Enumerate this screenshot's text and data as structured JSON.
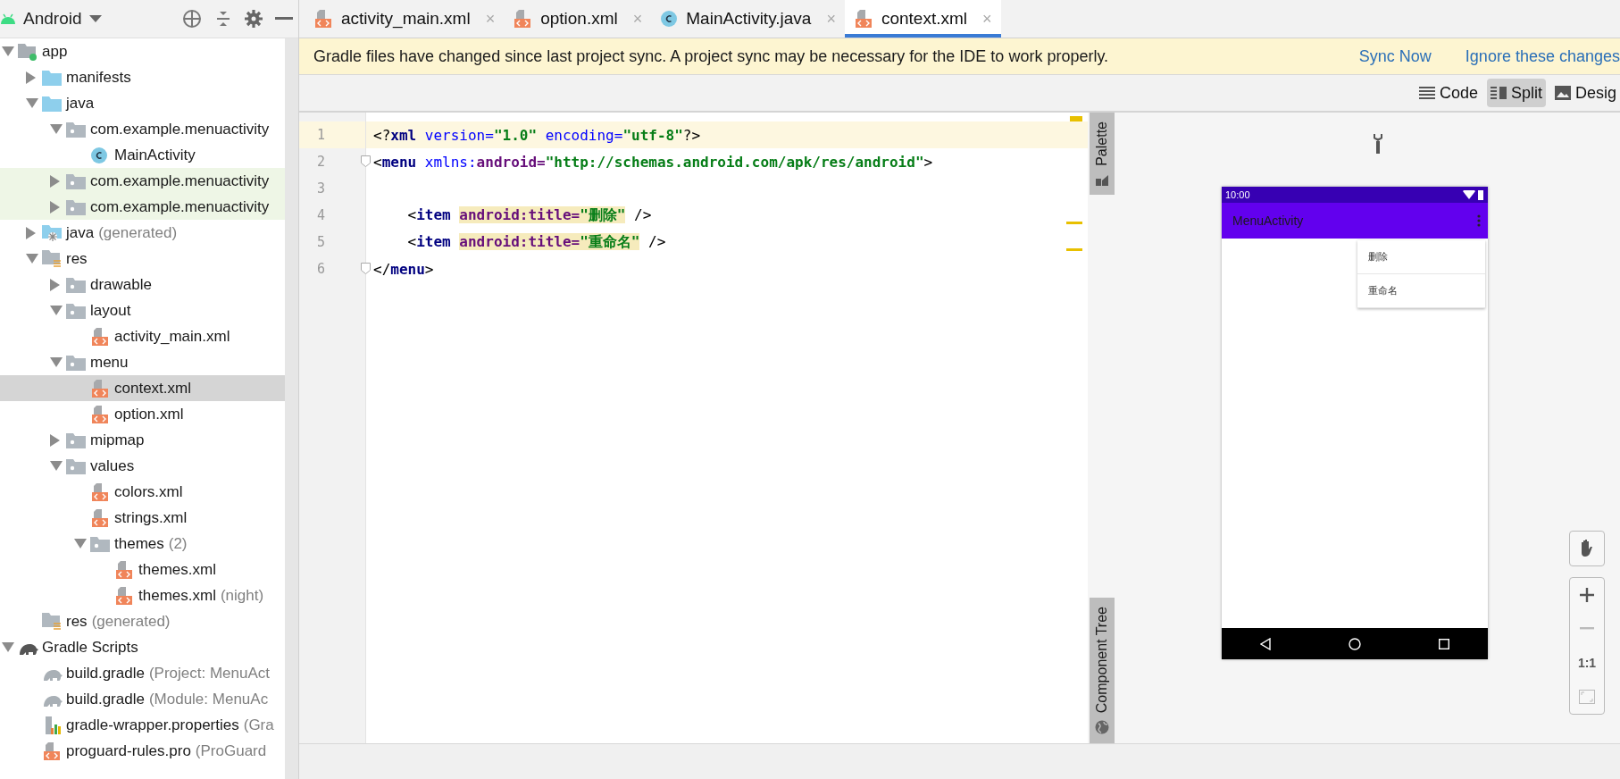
{
  "project_panel": {
    "view": "Android",
    "tree": [
      {
        "label": "app",
        "kind": "module",
        "expanded": true,
        "selected": false,
        "highlighted": false,
        "children": [
          {
            "label": "manifests",
            "kind": "folder",
            "expanded": false,
            "selected": false,
            "highlighted": false
          },
          {
            "label": "java",
            "kind": "folder",
            "expanded": true,
            "selected": false,
            "highlighted": false,
            "children": [
              {
                "label": "com.example.menuactivity",
                "kind": "package",
                "expanded": true,
                "selected": false,
                "highlighted": false,
                "children": [
                  {
                    "label": "MainActivity",
                    "kind": "class",
                    "selected": false,
                    "highlighted": false
                  }
                ]
              },
              {
                "label": "com.example.menuactivity",
                "kind": "package",
                "expanded": false,
                "selected": false,
                "highlighted": true
              },
              {
                "label": "com.example.menuactivity",
                "kind": "package",
                "expanded": false,
                "selected": false,
                "highlighted": true
              }
            ]
          },
          {
            "label": "java",
            "note": "(generated)",
            "kind": "generated",
            "expanded": false,
            "selected": false,
            "highlighted": false
          },
          {
            "label": "res",
            "kind": "res",
            "expanded": true,
            "selected": false,
            "highlighted": false,
            "children": [
              {
                "label": "drawable",
                "kind": "package",
                "expanded": false,
                "selected": false,
                "highlighted": false
              },
              {
                "label": "layout",
                "kind": "package",
                "expanded": true,
                "selected": false,
                "highlighted": false,
                "children": [
                  {
                    "label": "activity_main.xml",
                    "kind": "xml",
                    "selected": false,
                    "highlighted": false
                  }
                ]
              },
              {
                "label": "menu",
                "kind": "package",
                "expanded": true,
                "selected": false,
                "highlighted": false,
                "children": [
                  {
                    "label": "context.xml",
                    "kind": "xml",
                    "selected": true,
                    "highlighted": false
                  },
                  {
                    "label": "option.xml",
                    "kind": "xml",
                    "selected": false,
                    "highlighted": false
                  }
                ]
              },
              {
                "label": "mipmap",
                "kind": "package",
                "expanded": false,
                "selected": false,
                "highlighted": false
              },
              {
                "label": "values",
                "kind": "package",
                "expanded": true,
                "selected": false,
                "highlighted": false,
                "children": [
                  {
                    "label": "colors.xml",
                    "kind": "xml",
                    "selected": false,
                    "highlighted": false
                  },
                  {
                    "label": "strings.xml",
                    "kind": "xml",
                    "selected": false,
                    "highlighted": false
                  },
                  {
                    "label": "themes",
                    "note": "(2)",
                    "kind": "package",
                    "expanded": true,
                    "selected": false,
                    "highlighted": false,
                    "children": [
                      {
                        "label": "themes.xml",
                        "kind": "xml",
                        "selected": false,
                        "highlighted": false
                      },
                      {
                        "label": "themes.xml",
                        "note": "(night)",
                        "kind": "xml",
                        "selected": false,
                        "highlighted": false
                      }
                    ]
                  }
                ]
              }
            ]
          },
          {
            "label": "res",
            "note": "(generated)",
            "kind": "res",
            "selected": false,
            "highlighted": false
          }
        ]
      },
      {
        "label": "Gradle Scripts",
        "kind": "gradle",
        "expanded": true,
        "selected": false,
        "highlighted": false,
        "children": [
          {
            "label": "build.gradle",
            "note": "(Project: MenuAct",
            "kind": "gradle-file",
            "selected": false,
            "highlighted": false
          },
          {
            "label": "build.gradle",
            "note": "(Module: MenuAc",
            "kind": "gradle-file",
            "selected": false,
            "highlighted": false
          },
          {
            "label": "gradle-wrapper.properties",
            "note": "(Gra",
            "kind": "properties",
            "selected": false,
            "highlighted": false
          },
          {
            "label": "proguard-rules.pro",
            "note": "(ProGuard",
            "kind": "xml",
            "selected": false,
            "highlighted": false
          }
        ]
      }
    ]
  },
  "tabs": [
    {
      "label": "activity_main.xml",
      "kind": "xml",
      "close": "×",
      "selected": false
    },
    {
      "label": "option.xml",
      "kind": "xml",
      "close": "×",
      "selected": false
    },
    {
      "label": "MainActivity.java",
      "kind": "class",
      "close": "×",
      "selected": false
    },
    {
      "label": "context.xml",
      "kind": "xml",
      "close": "×",
      "selected": true
    }
  ],
  "banner": {
    "message": "Gradle files have changed since last project sync. A project sync may be necessary for the IDE to work properly.",
    "actions": [
      "Sync Now",
      "Ignore these changes"
    ]
  },
  "view_modes": [
    {
      "label": "Code",
      "kind": "code",
      "selected": false
    },
    {
      "label": "Split",
      "kind": "split",
      "selected": true
    },
    {
      "label": "Desig",
      "kind": "design",
      "selected": false
    }
  ],
  "editor": {
    "lines": [
      {
        "number": "1",
        "current": true,
        "warning": false,
        "fold": false,
        "tokens": [
          {
            "text": "<?",
            "kind": "punct"
          },
          {
            "text": "xml",
            "kind": "tag"
          },
          {
            "text": " version=",
            "kind": "attr"
          },
          {
            "text": "\"1.0\"",
            "kind": "value"
          },
          {
            "text": " encoding=",
            "kind": "attr"
          },
          {
            "text": "\"utf-8\"",
            "kind": "value"
          },
          {
            "text": "?>",
            "kind": "punct"
          }
        ]
      },
      {
        "number": "2",
        "current": false,
        "warning": false,
        "fold": true,
        "tokens": [
          {
            "text": "<",
            "kind": "punct"
          },
          {
            "text": "menu",
            "kind": "tag"
          },
          {
            "text": " xmlns:",
            "kind": "attr"
          },
          {
            "text": "android=",
            "kind": "ns"
          },
          {
            "text": "\"http://schemas.android.com/apk/res/android\"",
            "kind": "value"
          },
          {
            "text": ">",
            "kind": "punct"
          }
        ]
      },
      {
        "number": "3",
        "current": false,
        "warning": false,
        "fold": false
      },
      {
        "number": "4",
        "current": false,
        "warning": true,
        "fold": false,
        "tokens": [
          {
            "text": "    <",
            "kind": "punct"
          },
          {
            "text": "item ",
            "kind": "tag"
          },
          {
            "text": "android:title=",
            "kind": "ns-hl"
          },
          {
            "text": "\"删除\"",
            "kind": "value-hl"
          },
          {
            "text": " />",
            "kind": "punct"
          }
        ]
      },
      {
        "number": "5",
        "current": false,
        "warning": true,
        "fold": false,
        "tokens": [
          {
            "text": "    <",
            "kind": "punct"
          },
          {
            "text": "item ",
            "kind": "tag"
          },
          {
            "text": "android:title=",
            "kind": "ns-hl"
          },
          {
            "text": "\"重命名\"",
            "kind": "value-hl"
          },
          {
            "text": " />",
            "kind": "punct"
          }
        ]
      },
      {
        "number": "6",
        "current": false,
        "warning": false,
        "fold": true,
        "tokens": [
          {
            "text": "</",
            "kind": "punct"
          },
          {
            "text": "menu",
            "kind": "tag"
          },
          {
            "text": ">",
            "kind": "punct"
          }
        ]
      }
    ]
  },
  "side_tabs": [
    "Palette",
    "Component Tree"
  ],
  "preview": {
    "time": "10:00",
    "app_title": "MenuActivity",
    "menu_items": [
      "删除",
      "重命名"
    ],
    "zoom_label": "1:1"
  }
}
